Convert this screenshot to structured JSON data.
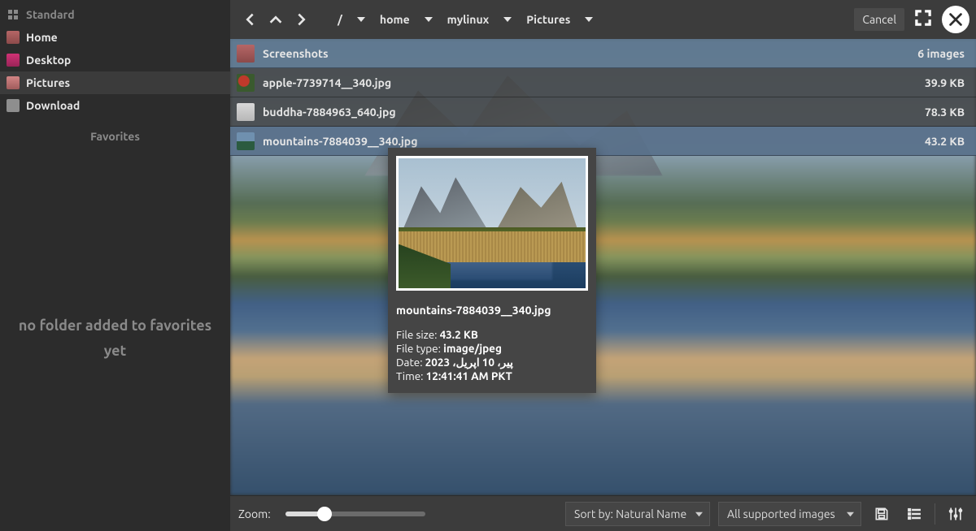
{
  "sidebar": {
    "type_label": "Standard",
    "items": [
      {
        "label": "Home"
      },
      {
        "label": "Desktop"
      },
      {
        "label": "Pictures"
      },
      {
        "label": "Download"
      }
    ],
    "favorites_label": "Favorites",
    "favorites_empty": "no folder added to favorites yet"
  },
  "breadcrumbs": {
    "root": "/",
    "parts": [
      "home",
      "mylinux",
      "Pictures"
    ]
  },
  "buttons": {
    "cancel": "Cancel"
  },
  "files": {
    "header": {
      "name": "Screenshots",
      "meta": "6 images"
    },
    "rows": [
      {
        "name": "apple-7739714__340.jpg",
        "size": "39.9 KB"
      },
      {
        "name": "buddha-7884963_640.jpg",
        "size": "78.3 KB"
      },
      {
        "name": "mountains-7884039__340.jpg",
        "size": "43.2 KB"
      }
    ]
  },
  "tooltip": {
    "name": "mountains-7884039__340.jpg",
    "size_label": "File size:",
    "size": "43.2 KB",
    "type_label": "File type:",
    "type": "image/jpeg",
    "date_label": "Date:",
    "date": "پیر، 10 اپریل، 2023",
    "time_label": "Time:",
    "time": "12:41:41 AM PKT"
  },
  "statusbar": {
    "zoom_label": "Zoom:",
    "sort_label": "Sort by: Natural Name",
    "filter_label": "All supported images"
  }
}
